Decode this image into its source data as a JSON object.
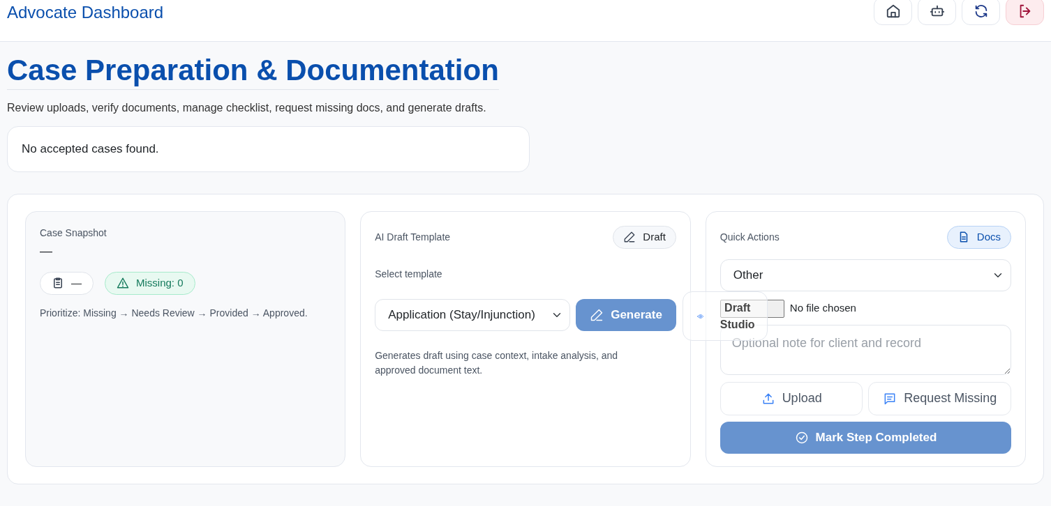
{
  "header": {
    "title": "Advocate Dashboard",
    "icon_buttons": [
      {
        "kind": "home"
      },
      {
        "kind": "bot"
      },
      {
        "kind": "refresh"
      },
      {
        "kind": "logout"
      }
    ]
  },
  "page": {
    "title": "Case Preparation & Documentation",
    "subtitle": "Review uploads, verify documents, manage checklist, request missing docs, and generate drafts.",
    "notice": "No accepted cases found."
  },
  "snapshot": {
    "label": "Case Snapshot",
    "case_name": "—",
    "checklist_chip": "—",
    "missing_chip": "Missing: 0",
    "hint": "Prioritize: Missing → Needs Review → Provided → Approved."
  },
  "draft": {
    "label": "AI Draft Template",
    "badge": "Draft",
    "select_label": "Select template",
    "template": "Application (Stay/Injunction)",
    "generate": {
      "label": "Generate",
      "disabled": true
    },
    "note": "Generates draft using case context, intake analysis, and approved document text."
  },
  "quick": {
    "label": "Quick Actions",
    "badge": "Docs",
    "doc_type": "Other",
    "file_status": "No file chosen",
    "note_placeholder": "Optional note for client and record",
    "upload": "Upload",
    "request": "Request Missing",
    "complete": {
      "label": "Mark Step Completed",
      "disabled": true
    }
  },
  "floating": {
    "label": "Draft Studio"
  }
}
